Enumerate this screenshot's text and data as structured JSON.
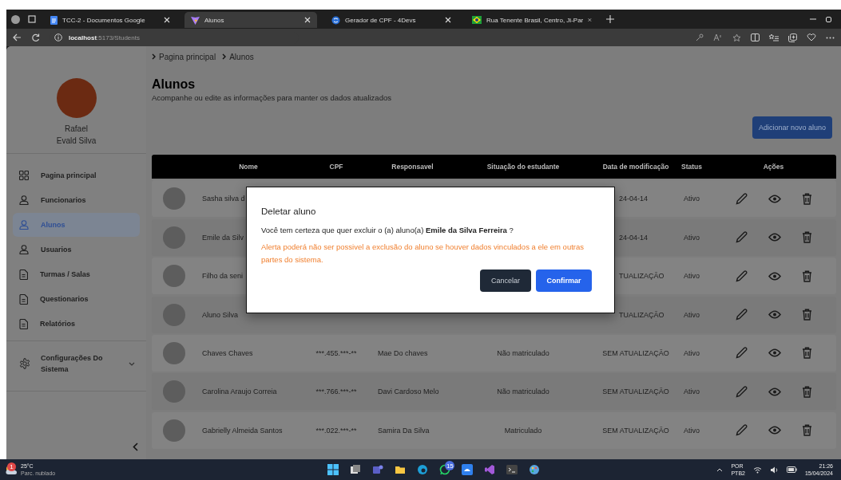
{
  "browser": {
    "tabs": [
      {
        "title": "TCC-2 - Documentos Google",
        "selected": false,
        "kind": "docs"
      },
      {
        "title": "Alunos",
        "selected": true,
        "kind": "vite"
      },
      {
        "title": "Gerador de CPF - 4Devs",
        "selected": false,
        "kind": "globe"
      },
      {
        "title": "Rua Tenente Brasil, Centro, Ji-Par",
        "selected": false,
        "kind": "flag"
      }
    ],
    "address": {
      "host": "localhost",
      "path": ":5173/Students"
    }
  },
  "sidebar": {
    "user": {
      "first_name": "Rafael",
      "last_name": "Evald Silva"
    },
    "items": [
      {
        "label": "Pagina principal",
        "selected": false,
        "kind": "grid"
      },
      {
        "label": "Funcionarios",
        "selected": false,
        "kind": "person"
      },
      {
        "label": "Alunos",
        "selected": true,
        "kind": "person"
      },
      {
        "label": "Usuarios",
        "selected": false,
        "kind": "person"
      },
      {
        "label": "Turmas / Salas",
        "selected": false,
        "kind": "document"
      },
      {
        "label": "Questionarios",
        "selected": false,
        "kind": "document"
      },
      {
        "label": "Relatórios",
        "selected": false,
        "kind": "document"
      }
    ],
    "settings": {
      "label": "Configurações Do Sistema",
      "expanded": false
    }
  },
  "breadcrumb": [
    "Pagina principal",
    "Alunos"
  ],
  "header": {
    "title": "Alunos",
    "subtitle": "Acompanhe ou edite as informações para manter os dados atualizados",
    "add_button": "Adicionar novo aluno"
  },
  "table": {
    "columns": [
      "Nome",
      "CPF",
      "Responsavel",
      "Situação do estudante",
      "Data de modificação",
      "Status",
      "Ações"
    ],
    "rows": [
      {
        "name": "Sasha silva d",
        "data": "24-04-14",
        "status": "Ativo"
      },
      {
        "name": "Emile da Silv",
        "data": "24-04-14",
        "status": "Ativo"
      },
      {
        "name": "Filho da seni",
        "data": "TUALIZAÇÃO",
        "status": "Ativo"
      },
      {
        "name": "Aluno Silva",
        "data": "TUALIZAÇÃO",
        "status": "Ativo"
      },
      {
        "name": "Chaves Chaves",
        "cpf": "***.455.***-**",
        "responsavel": "Mae Do chaves",
        "situacao": "Não matriculado",
        "data": "SEM ATUALIZAÇÃO",
        "status": "Ativo"
      },
      {
        "name": "Carolina Araujo Correia",
        "cpf": "***.766.***-**",
        "responsavel": "Davi Cardoso Melo",
        "situacao": "Não matriculado",
        "data": "SEM ATUALIZAÇÃO",
        "status": "Ativo"
      },
      {
        "name": "Gabrielly Almeida Santos",
        "cpf": "***.022.***-**",
        "responsavel": "Samira Da Silva",
        "situacao": "Matriculado",
        "data": "SEM ATUALIZAÇÃO",
        "status": "Ativo"
      }
    ]
  },
  "dialog": {
    "title": "Deletar aluno",
    "question": "Você tem certeza que quer excluir o (a) aluno(a) **Emile da Silva Ferreira** ?",
    "warning": "Alerta poderá não ser possivel a exclusão do aluno se houver dados vinculados a ele em outras partes do sistema.",
    "cancel": "Cancelar",
    "confirm": "Confirmar"
  },
  "taskbar": {
    "weather": {
      "temperature": "25°C",
      "condition": "Parc. nublado",
      "badge": "1"
    },
    "app_badge": "15",
    "language": "POR",
    "layout": "PTB2",
    "time": "21:26",
    "date": "15/04/2024"
  }
}
